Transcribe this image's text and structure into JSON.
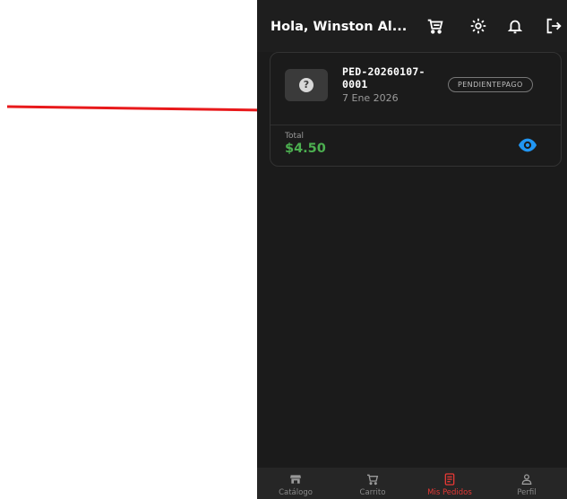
{
  "header": {
    "greeting": "Hola, Winston  Al...",
    "icons": [
      "cart-icon",
      "settings-icon",
      "bell-icon",
      "logout-icon"
    ]
  },
  "order": {
    "code": "PED-20260107-0001",
    "date": "7 Ene 2026",
    "status": "PENDIENTEPAGO",
    "total_label": "Total",
    "total_value": "$4.50",
    "icon": "question-icon"
  },
  "nav": {
    "items": [
      {
        "label": "Catálogo",
        "icon": "store-icon"
      },
      {
        "label": "Carrito",
        "icon": "cart-icon"
      },
      {
        "label": "Mis Pedidos",
        "icon": "receipt-icon",
        "active": true
      },
      {
        "label": "Perfil",
        "icon": "person-icon"
      }
    ]
  },
  "colors": {
    "accent": "#e53935",
    "total": "#4caf50",
    "view": "#2196f3",
    "arrow": "#e8191b"
  }
}
